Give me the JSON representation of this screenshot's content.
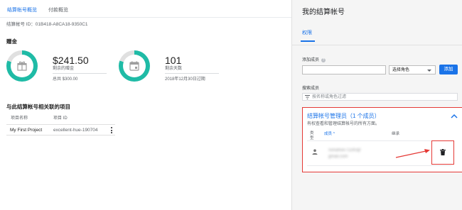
{
  "left": {
    "tabs": [
      {
        "label": "结算帐号概览",
        "active": true
      },
      {
        "label": "付款概览",
        "active": false
      }
    ],
    "account_id": "结算帐号 ID：01B418-A8CA18-9350C1",
    "credits_title": "赠金",
    "credit": {
      "amount": "$241.50",
      "label": "剩余的赠金",
      "total": "总共 $300.00",
      "remaining_fraction": 0.805
    },
    "days": {
      "value": "101",
      "label": "剩余天数",
      "expiry": "2018年12月30日过期"
    },
    "projects": {
      "title": "与此结算帐号相关联的项目",
      "col_name": "项目名称",
      "col_id": "项目 ID",
      "rows": [
        {
          "name": "My First Project",
          "id": "excellent-hue-190704"
        }
      ]
    }
  },
  "right": {
    "title": "我的结算帐号",
    "tab": "权限",
    "add_member_label": "添加成员",
    "select_role": "选择角色",
    "add_button": "添加",
    "search_member_label": "搜索成员",
    "filter_placeholder": "按名称或角色过滤",
    "admin_card": {
      "title": "结算帐号管理员（1 个成员）",
      "desc": "有权查看和管理结算帐号的所有方面。",
      "col_type": "类\n型",
      "col_member": "成员 ^",
      "col_inherit": "继承",
      "member_line1": "nonahoe71190@",
      "member_line2": "gmail.com"
    }
  },
  "colors": {
    "accent": "#1a73e8",
    "donut": "#1fbba6",
    "highlight": "#e53935"
  }
}
